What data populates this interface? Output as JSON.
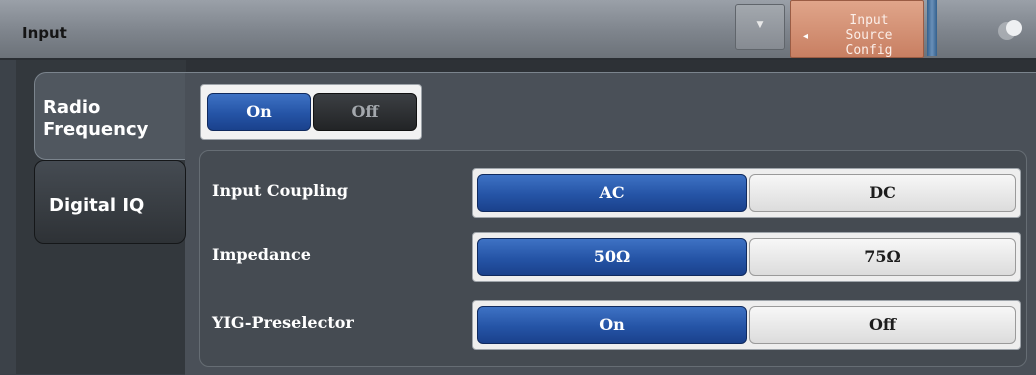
{
  "window": {
    "title": "Input",
    "dropdown_arrow": "▼",
    "source_button": {
      "label": "Input\nSource\nConfig",
      "arrow": "◂"
    }
  },
  "tabs": [
    {
      "label": "Radio\nFrequency",
      "active": true
    },
    {
      "label": "Digital IQ",
      "active": false
    }
  ],
  "rf_state": {
    "on_label": "On",
    "off_label": "Off",
    "selected": "On"
  },
  "settings": [
    {
      "label": "Input Coupling",
      "options": [
        "AC",
        "DC"
      ],
      "selected": "AC"
    },
    {
      "label": "Impedance",
      "options": [
        "50Ω",
        "75Ω"
      ],
      "selected": "50Ω"
    },
    {
      "label": "YIG-Preselector",
      "options": [
        "On",
        "Off"
      ],
      "selected": "On"
    }
  ],
  "colors": {
    "selected_blue": "#2554a6",
    "source_button": "#d4906f",
    "title_bar": "#858b92"
  },
  "icons": {
    "dropdown": "chevron-down-icon",
    "source_arrow": "arrow-left-icon",
    "top_right": "toggle-icon"
  }
}
